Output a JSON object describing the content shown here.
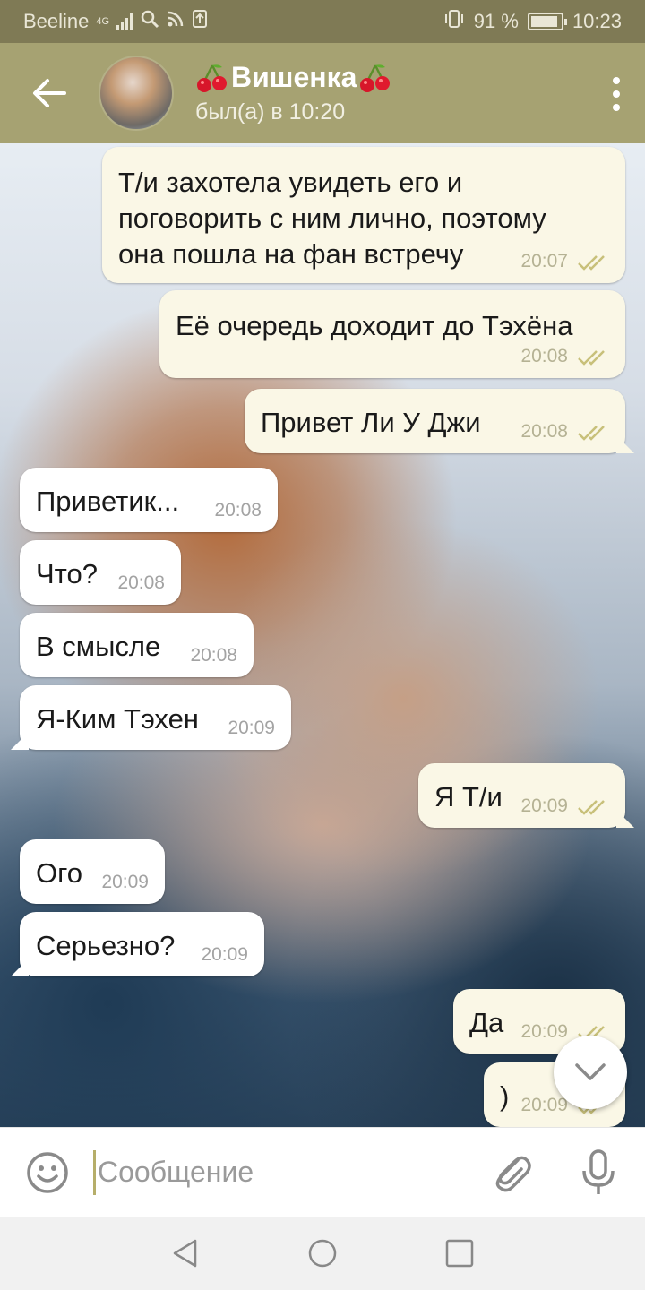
{
  "status_bar": {
    "carrier": "Beeline",
    "network": "4G",
    "battery": "91 %",
    "battery_level": 0.91,
    "time": "10:23"
  },
  "header": {
    "contact_name": "Вишенка",
    "last_seen": "был(а) в 10:20",
    "icons": [
      "back-arrow-icon",
      "cherry-icon",
      "more-icon"
    ]
  },
  "messages": [
    {
      "dir": "out",
      "lines": [
        "Т/и захотела увидеть его и",
        "поговорить с ним лично, поэтому",
        "она пошла на фан встречу"
      ],
      "time": "20:07",
      "read": true
    },
    {
      "dir": "out",
      "lines": [
        "Её очередь доходит до Тэхёна"
      ],
      "time": "20:08",
      "read": true
    },
    {
      "dir": "out",
      "lines": [
        "Привет Ли У Джи"
      ],
      "time": "20:08",
      "read": true
    },
    {
      "dir": "in",
      "lines": [
        "Приветик..."
      ],
      "time": "20:08"
    },
    {
      "dir": "in",
      "lines": [
        "Что?"
      ],
      "time": "20:08"
    },
    {
      "dir": "in",
      "lines": [
        "В смысле"
      ],
      "time": "20:08"
    },
    {
      "dir": "in",
      "lines": [
        "Я-Ким Тэхен"
      ],
      "time": "20:09"
    },
    {
      "dir": "out",
      "lines": [
        "Я Т/и"
      ],
      "time": "20:09",
      "read": true
    },
    {
      "dir": "in",
      "lines": [
        "Ого"
      ],
      "time": "20:09"
    },
    {
      "dir": "in",
      "lines": [
        "Серьезно?"
      ],
      "time": "20:09"
    },
    {
      "dir": "out",
      "lines": [
        "Да"
      ],
      "time": "20:09",
      "read": true
    },
    {
      "dir": "out",
      "lines": [
        ")"
      ],
      "time": "20:09",
      "read": true
    }
  ],
  "input": {
    "placeholder": "Сообщение"
  },
  "colors": {
    "header": "#a6a272",
    "status_bar": "#7f7a55",
    "outgoing_bubble": "#faf7e6",
    "incoming_bubble": "#ffffff",
    "read_checks": "#c8c07a"
  }
}
